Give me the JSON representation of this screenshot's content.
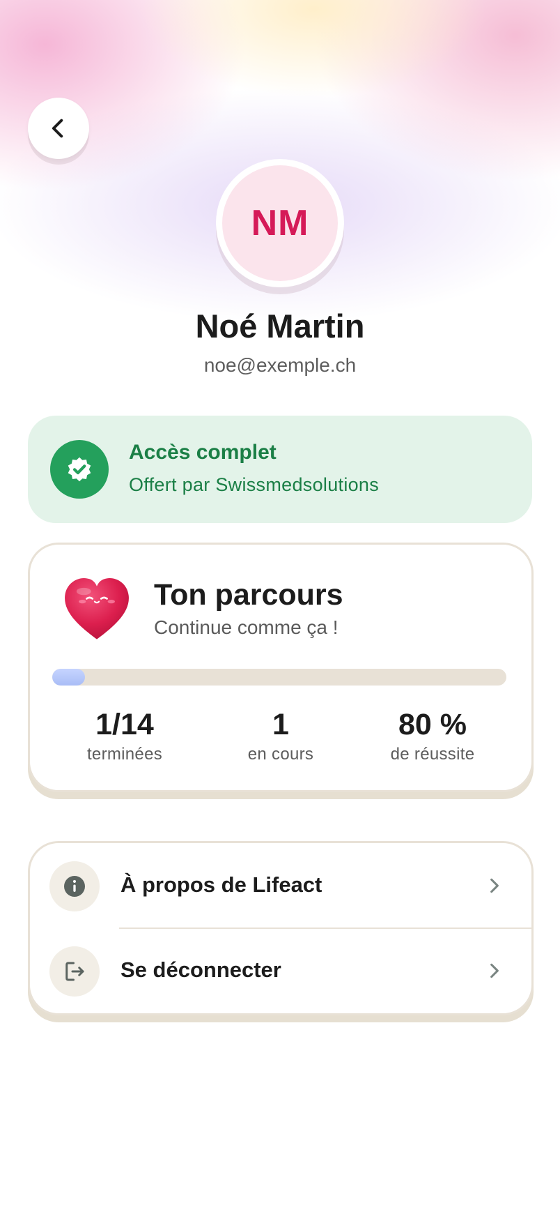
{
  "header": {
    "back_icon": "chevron-left-icon"
  },
  "profile": {
    "initials": "NM",
    "name": "Noé Martin",
    "email": "noe@exemple.ch",
    "avatar_color": "#d51a58",
    "avatar_bg": "#fbe4ec"
  },
  "access": {
    "icon": "verified-badge-icon",
    "title": "Accès complet",
    "subtitle": "Offert par Swissmedsolutions",
    "color": "#1b7f46",
    "bg": "#e3f3e9"
  },
  "journey": {
    "icon": "heart-icon",
    "title": "Ton parcours",
    "subtitle": "Continue comme ça !",
    "progress_fraction": 0.0714,
    "stats": [
      {
        "value": "1/14",
        "label": "terminées"
      },
      {
        "value": "1",
        "label": "en cours"
      },
      {
        "value": "80 %",
        "label": "de réussite"
      }
    ]
  },
  "menu": {
    "items": [
      {
        "icon": "info-icon",
        "label": "À propos de Lifeact",
        "chevron": "chevron-right-icon"
      },
      {
        "icon": "logout-icon",
        "label": "Se déconnecter",
        "chevron": "chevron-right-icon"
      }
    ]
  }
}
